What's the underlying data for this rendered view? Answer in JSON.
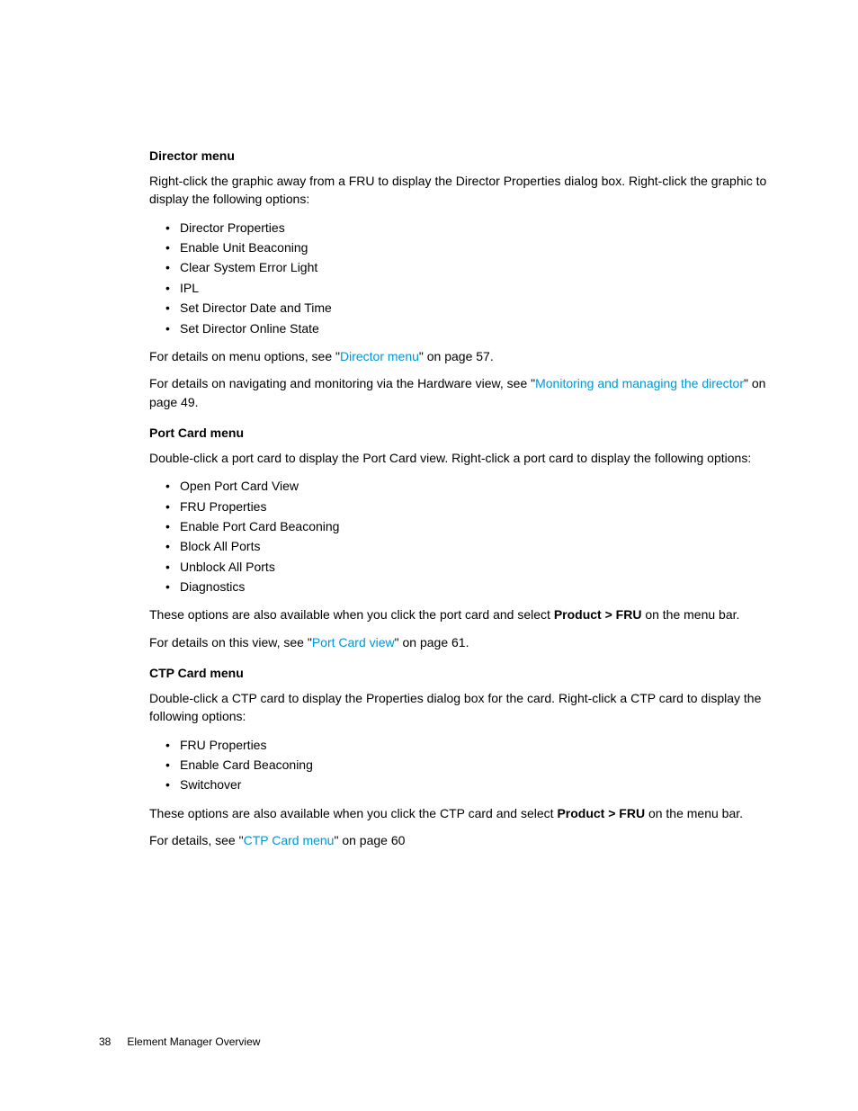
{
  "footer": {
    "page_number": "38",
    "chapter_title": "Element Manager Overview"
  },
  "sections": {
    "director": {
      "heading": "Director menu",
      "intro": "Right-click the graphic away from a FRU to display the Director Properties dialog box. Right-click the graphic to display the following options:",
      "items": [
        "Director Properties",
        "Enable Unit Beaconing",
        "Clear System Error Light",
        "IPL",
        "Set Director Date and Time",
        "Set Director Online State"
      ],
      "after1_pre": "For details on menu options, see \"",
      "after1_link": "Director menu",
      "after1_post": "\" on page 57.",
      "after2_pre": "For details on navigating and monitoring via the Hardware view, see \"",
      "after2_link": "Monitoring and managing the director",
      "after2_post": "\" on page 49."
    },
    "portcard": {
      "heading": "Port Card menu",
      "intro": "Double-click a port card to display the Port Card view. Right-click a port card to display the following options:",
      "items": [
        "Open Port Card View",
        "FRU Properties",
        "Enable Port Card Beaconing",
        "Block All Ports",
        "Unblock All Ports",
        "Diagnostics"
      ],
      "after1_pre": "These options are also available when you click the port card and select ",
      "after1_bold": "Product > FRU",
      "after1_post": " on the menu bar.",
      "after2_pre": "For details on this view, see \"",
      "after2_link": "Port Card view",
      "after2_post": "\" on page 61."
    },
    "ctpcard": {
      "heading": "CTP Card menu",
      "intro": "Double-click a CTP card to display the Properties dialog box for the card. Right-click a CTP card to display the following options:",
      "items": [
        "FRU Properties",
        "Enable Card Beaconing",
        "Switchover"
      ],
      "after1_pre": "These options are also available when you click the CTP card and select ",
      "after1_bold": "Product > FRU",
      "after1_post": " on the menu bar.",
      "after2_pre": "For details, see \"",
      "after2_link": "CTP Card menu",
      "after2_post": "\" on page 60"
    }
  }
}
